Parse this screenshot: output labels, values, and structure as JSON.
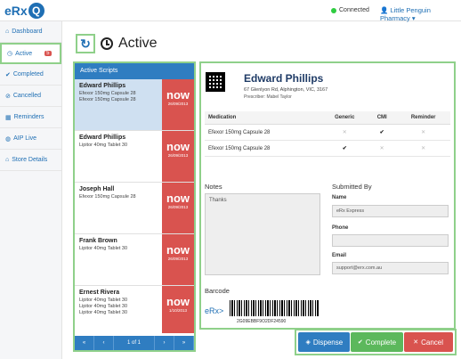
{
  "app": {
    "logo": "eRx",
    "logo_mark": "Q"
  },
  "topbar": {
    "status": "Connected",
    "pharmacy": "Little Penguin Pharmacy ▾",
    "status_color": "#2ecc40"
  },
  "sidebar": {
    "items": [
      {
        "label": "Dashboard",
        "icon": "home-icon"
      },
      {
        "label": "Active",
        "icon": "clock-icon",
        "badge": "5"
      },
      {
        "label": "Completed",
        "icon": "check-circle-icon"
      },
      {
        "label": "Cancelled",
        "icon": "ban-icon"
      },
      {
        "label": "Reminders",
        "icon": "calendar-icon"
      },
      {
        "label": "AIP Live",
        "icon": "globe-icon"
      },
      {
        "label": "Store Details",
        "icon": "home-icon"
      }
    ]
  },
  "page": {
    "title": "Active"
  },
  "scripts": {
    "header": "Active Scripts",
    "items": [
      {
        "name": "Edward Phillips",
        "lines": [
          "Efexor 150mg Capsule 28",
          "Efexor 150mg Capsule 28"
        ],
        "status": "now",
        "date": "26/09/2013"
      },
      {
        "name": "Edward Phillips",
        "lines": [
          "Lipitor 40mg Tablet 30"
        ],
        "status": "now",
        "date": "26/09/2013"
      },
      {
        "name": "Joseph Hall",
        "lines": [
          "Efexor 150mg Capsule 28"
        ],
        "status": "now",
        "date": "26/09/2013"
      },
      {
        "name": "Frank Brown",
        "lines": [
          "Lipitor 40mg Tablet 30"
        ],
        "status": "now",
        "date": "26/09/2013"
      },
      {
        "name": "Ernest Rivera",
        "lines": [
          "Lipitor 40mg Tablet 30",
          "Lipitor 40mg Tablet 30",
          "Lipitor 40mg Tablet 30"
        ],
        "status": "now",
        "date": "1/10/2013"
      }
    ],
    "pager": {
      "first": "«",
      "prev": "‹",
      "page": "1 of 1",
      "next": "›",
      "last": "»"
    }
  },
  "detail": {
    "patient_name": "Edward Phillips",
    "address": "67 Glenlyon Rd, Alphington, VIC, 3167",
    "prescriber": "Prescriber: Mabel Taylor",
    "med_headers": {
      "medication": "Medication",
      "generic": "Generic",
      "cmi": "CMI",
      "reminder": "Reminder"
    },
    "meds": [
      {
        "name": "Efexor 150mg Capsule 28",
        "generic": "✕",
        "cmi": "✔",
        "reminder": "✕"
      },
      {
        "name": "Efexor 150mg Capsule 28",
        "generic": "✔",
        "cmi": "✕",
        "reminder": "✕"
      }
    ],
    "notes_label": "Notes",
    "notes_value": "Thanks",
    "submitted_label": "Submitted By",
    "name_label": "Name",
    "name_value": "eRx Express",
    "phone_label": "Phone",
    "phone_value": "",
    "email_label": "Email",
    "email_value": "support@erx.com.au",
    "barcode_label": "Barcode",
    "barcode_logo": "eRx>",
    "barcode_number": "2G09EBBF9O2DF24590"
  },
  "actions": {
    "dispense": "Dispense",
    "complete": "Complete",
    "cancel": "Cancel"
  }
}
